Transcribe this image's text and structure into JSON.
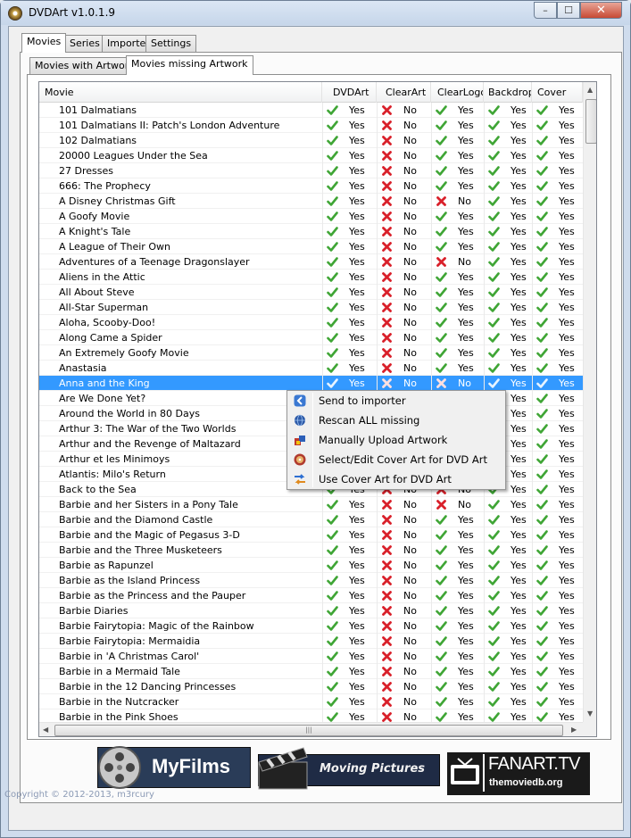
{
  "window": {
    "title": "DVDArt v1.0.1.9",
    "controls": {
      "minimize": "–",
      "maximize": "☐",
      "close": "✕"
    }
  },
  "tabs": [
    "Movies",
    "Series",
    "Importer",
    "Settings"
  ],
  "subtabs": [
    "Movies with Artwork",
    "Movies missing Artwork"
  ],
  "grid": {
    "columns": [
      "Movie",
      "DVDArt",
      "ClearArt",
      "ClearLogo",
      "Backdrop",
      "Cover"
    ],
    "rows": [
      {
        "movie": "101 Dalmatians",
        "s": [
          "Yes",
          "No",
          "Yes",
          "Yes",
          "Yes"
        ]
      },
      {
        "movie": "101 Dalmatians II: Patch's London Adventure",
        "s": [
          "Yes",
          "No",
          "Yes",
          "Yes",
          "Yes"
        ]
      },
      {
        "movie": "102 Dalmatians",
        "s": [
          "Yes",
          "No",
          "Yes",
          "Yes",
          "Yes"
        ]
      },
      {
        "movie": "20000 Leagues Under the Sea",
        "s": [
          "Yes",
          "No",
          "Yes",
          "Yes",
          "Yes"
        ]
      },
      {
        "movie": "27 Dresses",
        "s": [
          "Yes",
          "No",
          "Yes",
          "Yes",
          "Yes"
        ]
      },
      {
        "movie": "666: The Prophecy",
        "s": [
          "Yes",
          "No",
          "Yes",
          "Yes",
          "Yes"
        ]
      },
      {
        "movie": "A Disney Christmas Gift",
        "s": [
          "Yes",
          "No",
          "No",
          "Yes",
          "Yes"
        ]
      },
      {
        "movie": "A Goofy Movie",
        "s": [
          "Yes",
          "No",
          "Yes",
          "Yes",
          "Yes"
        ]
      },
      {
        "movie": "A Knight's Tale",
        "s": [
          "Yes",
          "No",
          "Yes",
          "Yes",
          "Yes"
        ]
      },
      {
        "movie": "A League of Their Own",
        "s": [
          "Yes",
          "No",
          "Yes",
          "Yes",
          "Yes"
        ]
      },
      {
        "movie": "Adventures of a Teenage Dragonslayer",
        "s": [
          "Yes",
          "No",
          "No",
          "Yes",
          "Yes"
        ]
      },
      {
        "movie": "Aliens in the Attic",
        "s": [
          "Yes",
          "No",
          "Yes",
          "Yes",
          "Yes"
        ]
      },
      {
        "movie": "All About Steve",
        "s": [
          "Yes",
          "No",
          "Yes",
          "Yes",
          "Yes"
        ]
      },
      {
        "movie": "All-Star Superman",
        "s": [
          "Yes",
          "No",
          "Yes",
          "Yes",
          "Yes"
        ]
      },
      {
        "movie": "Aloha, Scooby-Doo!",
        "s": [
          "Yes",
          "No",
          "Yes",
          "Yes",
          "Yes"
        ]
      },
      {
        "movie": "Along Came a Spider",
        "s": [
          "Yes",
          "No",
          "Yes",
          "Yes",
          "Yes"
        ]
      },
      {
        "movie": "An Extremely Goofy Movie",
        "s": [
          "Yes",
          "No",
          "Yes",
          "Yes",
          "Yes"
        ]
      },
      {
        "movie": "Anastasia",
        "s": [
          "Yes",
          "No",
          "Yes",
          "Yes",
          "Yes"
        ]
      },
      {
        "movie": "Anna and the King",
        "s": [
          "Yes",
          "No",
          "No",
          "Yes",
          "Yes"
        ],
        "selected": true
      },
      {
        "movie": "Are We Done Yet?",
        "s": [
          "Yes",
          "No",
          "Yes",
          "Yes",
          "Yes"
        ]
      },
      {
        "movie": "Around the World in 80 Days",
        "s": [
          "Yes",
          "No",
          "Yes",
          "Yes",
          "Yes"
        ]
      },
      {
        "movie": "Arthur 3: The War of the Two Worlds",
        "s": [
          "Yes",
          "No",
          "Yes",
          "Yes",
          "Yes"
        ]
      },
      {
        "movie": "Arthur and the Revenge of Maltazard",
        "s": [
          "Yes",
          "No",
          "Yes",
          "Yes",
          "Yes"
        ]
      },
      {
        "movie": "Arthur et les Minimoys",
        "s": [
          "Yes",
          "No",
          "Yes",
          "Yes",
          "Yes"
        ]
      },
      {
        "movie": "Atlantis: Milo's Return",
        "s": [
          "Yes",
          "No",
          "Yes",
          "Yes",
          "Yes"
        ]
      },
      {
        "movie": "Back to the Sea",
        "s": [
          "Yes",
          "No",
          "No",
          "Yes",
          "Yes"
        ]
      },
      {
        "movie": "Barbie and her Sisters in a Pony Tale",
        "s": [
          "Yes",
          "No",
          "No",
          "Yes",
          "Yes"
        ]
      },
      {
        "movie": "Barbie and the Diamond Castle",
        "s": [
          "Yes",
          "No",
          "Yes",
          "Yes",
          "Yes"
        ]
      },
      {
        "movie": "Barbie and the Magic of Pegasus 3-D",
        "s": [
          "Yes",
          "No",
          "Yes",
          "Yes",
          "Yes"
        ]
      },
      {
        "movie": "Barbie and the Three Musketeers",
        "s": [
          "Yes",
          "No",
          "Yes",
          "Yes",
          "Yes"
        ]
      },
      {
        "movie": "Barbie as Rapunzel",
        "s": [
          "Yes",
          "No",
          "Yes",
          "Yes",
          "Yes"
        ]
      },
      {
        "movie": "Barbie as the Island Princess",
        "s": [
          "Yes",
          "No",
          "Yes",
          "Yes",
          "Yes"
        ]
      },
      {
        "movie": "Barbie as the Princess and the Pauper",
        "s": [
          "Yes",
          "No",
          "Yes",
          "Yes",
          "Yes"
        ]
      },
      {
        "movie": "Barbie Diaries",
        "s": [
          "Yes",
          "No",
          "Yes",
          "Yes",
          "Yes"
        ]
      },
      {
        "movie": "Barbie Fairytopia: Magic of the Rainbow",
        "s": [
          "Yes",
          "No",
          "Yes",
          "Yes",
          "Yes"
        ]
      },
      {
        "movie": "Barbie Fairytopia: Mermaidia",
        "s": [
          "Yes",
          "No",
          "Yes",
          "Yes",
          "Yes"
        ]
      },
      {
        "movie": "Barbie in 'A Christmas Carol'",
        "s": [
          "Yes",
          "No",
          "Yes",
          "Yes",
          "Yes"
        ]
      },
      {
        "movie": "Barbie in a Mermaid Tale",
        "s": [
          "Yes",
          "No",
          "Yes",
          "Yes",
          "Yes"
        ]
      },
      {
        "movie": "Barbie in the 12 Dancing Princesses",
        "s": [
          "Yes",
          "No",
          "Yes",
          "Yes",
          "Yes"
        ]
      },
      {
        "movie": "Barbie in the Nutcracker",
        "s": [
          "Yes",
          "No",
          "Yes",
          "Yes",
          "Yes"
        ]
      },
      {
        "movie": "Barbie in the Pink Shoes",
        "s": [
          "Yes",
          "No",
          "Yes",
          "Yes",
          "Yes"
        ]
      }
    ]
  },
  "context_menu": [
    {
      "label": "Send to importer",
      "icon": "back-arrow-icon"
    },
    {
      "label": "Rescan ALL missing",
      "icon": "globe-icon"
    },
    {
      "label": "Manually Upload Artwork",
      "icon": "upload-icon"
    },
    {
      "label": "Select/Edit Cover Art for DVD Art",
      "icon": "disc-icon"
    },
    {
      "label": "Use Cover Art for DVD Art",
      "icon": "convert-icon"
    }
  ],
  "banner": {
    "myfilms": "MyFilms",
    "movingpictures": "Moving Pictures",
    "fanart": "FANART.TV",
    "tmdb": "themoviedb.org"
  },
  "copyright": "Copyright © 2012-2013, m3rcury",
  "colors": {
    "yes": "#3fa535",
    "no": "#d9202a",
    "selection": "#3399ff"
  }
}
